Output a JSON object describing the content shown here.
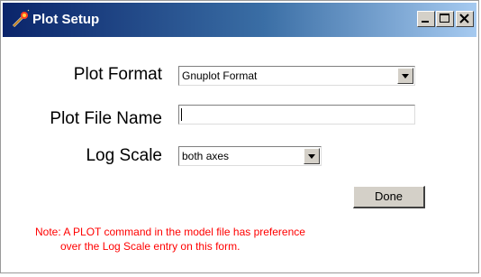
{
  "window": {
    "title": "Plot Setup",
    "icon": "wand-icon",
    "controls": {
      "minimize": "minimize-icon",
      "maximize": "maximize-icon",
      "close": "close-icon"
    }
  },
  "form": {
    "plot_format_label": "Plot Format",
    "plot_format_value": "Gnuplot Format",
    "plot_file_label": "Plot File Name",
    "plot_file_value": "",
    "log_scale_label": "Log Scale",
    "log_scale_value": "both axes",
    "done_label": "Done"
  },
  "note": {
    "line1": "Note: A PLOT command in the model file has preference",
    "line2": "over the Log Scale entry on this form."
  },
  "colors": {
    "title_bar_start": "#0a246a",
    "title_bar_end": "#a6caf0",
    "note": "#ff0000",
    "button_face": "#d4d0c8"
  }
}
